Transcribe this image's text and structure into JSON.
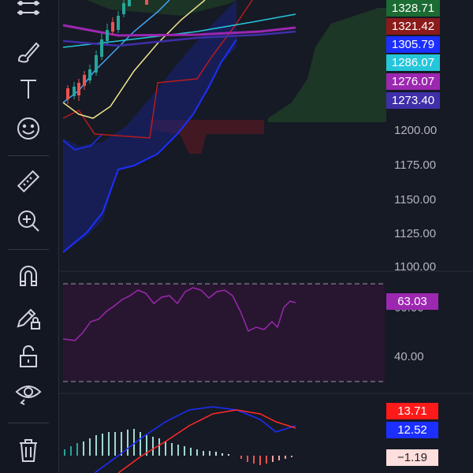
{
  "toolbar": {
    "tools": [
      {
        "name": "trend-lines-icon"
      },
      {
        "name": "brush-icon"
      },
      {
        "name": "text-icon"
      },
      {
        "name": "emoji-icon"
      },
      {
        "name": "ruler-icon"
      },
      {
        "name": "zoom-in-icon"
      },
      {
        "name": "magnet-icon"
      },
      {
        "name": "lock-drawing-icon"
      },
      {
        "name": "unlock-icon"
      },
      {
        "name": "eye-icon"
      },
      {
        "name": "trash-icon"
      }
    ]
  },
  "price_labels": [
    {
      "text": "1328.71",
      "bg": "#1b6b32"
    },
    {
      "text": "1321.42",
      "bg": "#8b1a1a"
    },
    {
      "text": "1305.79",
      "bg": "#1c2fff"
    },
    {
      "text": "1286.07",
      "bg": "#26c6da"
    },
    {
      "text": "1276.07",
      "bg": "#9c27b0"
    },
    {
      "text": "1273.40",
      "bg": "#3f2fa8"
    }
  ],
  "price_axis": [
    "1200.00",
    "1175.00",
    "1150.00",
    "1125.00",
    "1100.00"
  ],
  "rsi": {
    "value_label": "63.03",
    "value_bg": "#9c27b0",
    "axis": [
      "60.00",
      "40.00"
    ]
  },
  "macd": {
    "labels": [
      {
        "text": "13.71",
        "bg": "#ff1a1a",
        "color": "#ffffff"
      },
      {
        "text": "12.52",
        "bg": "#1c2fff",
        "color": "#ffffff"
      },
      {
        "text": "−1.19",
        "bg": "#ffdede",
        "color": "#222222"
      }
    ]
  },
  "colors": {
    "background": "#161a25",
    "bull_candle": "#26a69a",
    "bear_candle": "#ef5350",
    "cloud_green": "#1e3b27",
    "rsi_line": "#9c27b0",
    "macd_line": "#1c2fff",
    "signal_line": "#ff2a2a"
  }
}
